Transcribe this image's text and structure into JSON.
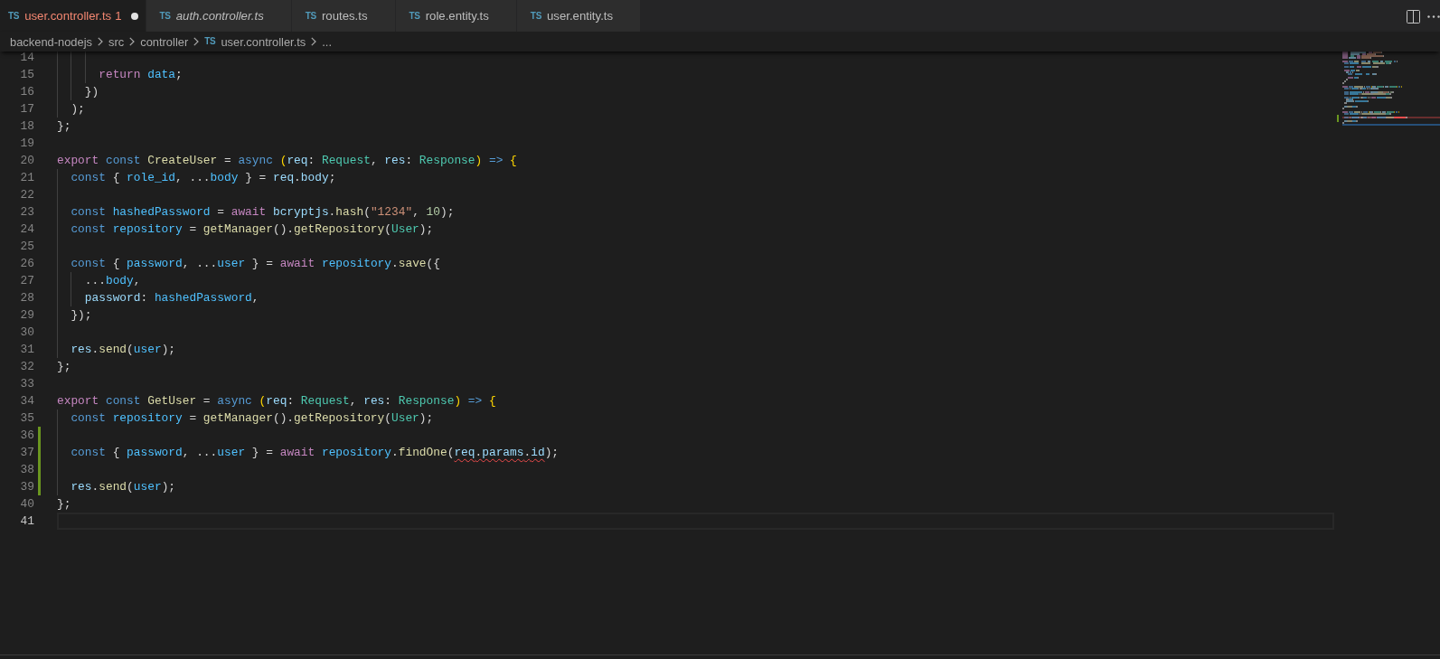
{
  "tabs": [
    {
      "icon": "TS",
      "label": "user.controller.ts",
      "problems": "1",
      "selected": true,
      "preview": false,
      "error": true,
      "dirty": true
    },
    {
      "icon": "TS",
      "label": "auth.controller.ts",
      "selected": false,
      "preview": true,
      "error": false,
      "dirty": false
    },
    {
      "icon": "TS",
      "label": "routes.ts",
      "selected": false,
      "preview": false,
      "error": false,
      "dirty": false
    },
    {
      "icon": "TS",
      "label": "role.entity.ts",
      "selected": false,
      "preview": false,
      "error": false,
      "dirty": false
    },
    {
      "icon": "TS",
      "label": "user.entity.ts",
      "selected": false,
      "preview": false,
      "error": false,
      "dirty": false
    }
  ],
  "breadcrumbs": [
    {
      "kind": "folder",
      "text": "backend-nodejs"
    },
    {
      "kind": "folder",
      "text": "src"
    },
    {
      "kind": "folder",
      "text": "controller"
    },
    {
      "kind": "file",
      "icon": "TS",
      "text": "user.controller.ts"
    },
    {
      "kind": "symbol",
      "text": "..."
    }
  ],
  "editor": {
    "lines": [
      {
        "kind": "block",
        "children": [
          {
            "kind": "block",
            "children": [
              {
                "kind": "block",
                "children": [
                  {
                    "kind": "line",
                    "number": "14",
                    "added": false,
                    "active": false
                  },
                  {
                    "kind": "line",
                    "number": "15",
                    "added": false,
                    "active": false,
                    "tokens": [
                      {
                        "kind": "keyword",
                        "text": "return "
                      },
                      {
                        "kind": "constant",
                        "text": "data"
                      },
                      {
                        "kind": "punct",
                        "text": ";"
                      }
                    ]
                  }
                ]
              },
              {
                "kind": "line",
                "number": "16",
                "added": false,
                "active": false,
                "tokens": [
                  {
                    "kind": "punct",
                    "text": "})"
                  }
                ]
              }
            ]
          },
          {
            "kind": "line",
            "number": "17",
            "added": false,
            "active": false,
            "tokens": [
              {
                "kind": "punct",
                "text": ");"
              }
            ]
          }
        ]
      },
      {
        "kind": "line",
        "number": "18",
        "added": false,
        "active": false,
        "tokens": [
          {
            "kind": "punct",
            "text": "};"
          }
        ]
      },
      {
        "kind": "line",
        "number": "19",
        "added": false,
        "active": false
      },
      {
        "kind": "line",
        "number": "20",
        "added": false,
        "active": false,
        "tokens": [
          {
            "kind": "keyword",
            "text": "export "
          },
          {
            "kind": "storage",
            "text": "const "
          },
          {
            "kind": "function",
            "text": "CreateUser"
          },
          {
            "kind": "punct",
            "text": " = "
          },
          {
            "kind": "storage",
            "text": "async "
          },
          {
            "kind": "bracket",
            "text": "("
          },
          {
            "kind": "variable",
            "text": "req"
          },
          {
            "kind": "punct",
            "text": ": "
          },
          {
            "kind": "type",
            "text": "Request"
          },
          {
            "kind": "punct",
            "text": ", "
          },
          {
            "kind": "variable",
            "text": "res"
          },
          {
            "kind": "punct",
            "text": ": "
          },
          {
            "kind": "type",
            "text": "Response"
          },
          {
            "kind": "bracket",
            "text": ")"
          },
          {
            "kind": "storage",
            "text": " => "
          },
          {
            "kind": "bracket",
            "text": "{"
          }
        ]
      },
      {
        "kind": "block",
        "children": [
          {
            "kind": "line",
            "number": "21",
            "added": false,
            "active": false,
            "tokens": [
              {
                "kind": "storage",
                "text": "const "
              },
              {
                "kind": "punct",
                "text": "{ "
              },
              {
                "kind": "constant",
                "text": "role_id"
              },
              {
                "kind": "punct",
                "text": ", ..."
              },
              {
                "kind": "constant",
                "text": "body"
              },
              {
                "kind": "punct",
                "text": " } = "
              },
              {
                "kind": "variable",
                "text": "req"
              },
              {
                "kind": "punct",
                "text": "."
              },
              {
                "kind": "variable",
                "text": "body"
              },
              {
                "kind": "punct",
                "text": ";"
              }
            ]
          },
          {
            "kind": "line",
            "number": "22",
            "added": false,
            "active": false
          },
          {
            "kind": "line",
            "number": "23",
            "added": false,
            "active": false,
            "tokens": [
              {
                "kind": "storage",
                "text": "const "
              },
              {
                "kind": "constant",
                "text": "hashedPassword"
              },
              {
                "kind": "punct",
                "text": " = "
              },
              {
                "kind": "keyword",
                "text": "await "
              },
              {
                "kind": "variable",
                "text": "bcryptjs"
              },
              {
                "kind": "punct",
                "text": "."
              },
              {
                "kind": "function",
                "text": "hash"
              },
              {
                "kind": "punct",
                "text": "("
              },
              {
                "kind": "string",
                "text": "\"1234\""
              },
              {
                "kind": "punct",
                "text": ", "
              },
              {
                "kind": "number",
                "text": "10"
              },
              {
                "kind": "punct",
                "text": ");"
              }
            ]
          },
          {
            "kind": "line",
            "number": "24",
            "added": false,
            "active": false,
            "tokens": [
              {
                "kind": "storage",
                "text": "const "
              },
              {
                "kind": "constant",
                "text": "repository"
              },
              {
                "kind": "punct",
                "text": " = "
              },
              {
                "kind": "function",
                "text": "getManager"
              },
              {
                "kind": "punct",
                "text": "()."
              },
              {
                "kind": "function",
                "text": "getRepository"
              },
              {
                "kind": "punct",
                "text": "("
              },
              {
                "kind": "type",
                "text": "User"
              },
              {
                "kind": "punct",
                "text": ");"
              }
            ]
          },
          {
            "kind": "line",
            "number": "25",
            "added": false,
            "active": false
          },
          {
            "kind": "line",
            "number": "26",
            "added": false,
            "active": false,
            "tokens": [
              {
                "kind": "storage",
                "text": "const "
              },
              {
                "kind": "punct",
                "text": "{ "
              },
              {
                "kind": "constant",
                "text": "password"
              },
              {
                "kind": "punct",
                "text": ", ..."
              },
              {
                "kind": "constant",
                "text": "user"
              },
              {
                "kind": "punct",
                "text": " } = "
              },
              {
                "kind": "keyword",
                "text": "await "
              },
              {
                "kind": "constant",
                "text": "repository"
              },
              {
                "kind": "punct",
                "text": "."
              },
              {
                "kind": "function",
                "text": "save"
              },
              {
                "kind": "punct",
                "text": "({"
              }
            ]
          },
          {
            "kind": "block",
            "children": [
              {
                "kind": "line",
                "number": "27",
                "added": false,
                "active": false,
                "tokens": [
                  {
                    "kind": "punct",
                    "text": "..."
                  },
                  {
                    "kind": "constant",
                    "text": "body"
                  },
                  {
                    "kind": "punct",
                    "text": ","
                  }
                ]
              },
              {
                "kind": "line",
                "number": "28",
                "added": false,
                "active": false,
                "tokens": [
                  {
                    "kind": "variable",
                    "text": "password"
                  },
                  {
                    "kind": "punct",
                    "text": ": "
                  },
                  {
                    "kind": "constant",
                    "text": "hashedPassword"
                  },
                  {
                    "kind": "punct",
                    "text": ","
                  }
                ]
              }
            ]
          },
          {
            "kind": "line",
            "number": "29",
            "added": false,
            "active": false,
            "tokens": [
              {
                "kind": "punct",
                "text": "});"
              }
            ]
          },
          {
            "kind": "line",
            "number": "30",
            "added": false,
            "active": false
          },
          {
            "kind": "line",
            "number": "31",
            "added": false,
            "active": false,
            "tokens": [
              {
                "kind": "variable",
                "text": "res"
              },
              {
                "kind": "punct",
                "text": "."
              },
              {
                "kind": "function",
                "text": "send"
              },
              {
                "kind": "punct",
                "text": "("
              },
              {
                "kind": "constant",
                "text": "user"
              },
              {
                "kind": "punct",
                "text": ");"
              }
            ]
          }
        ]
      },
      {
        "kind": "line",
        "number": "32",
        "added": false,
        "active": false,
        "tokens": [
          {
            "kind": "punct",
            "text": "};"
          }
        ]
      },
      {
        "kind": "line",
        "number": "33",
        "added": false,
        "active": false
      },
      {
        "kind": "line",
        "number": "34",
        "added": false,
        "active": false,
        "tokens": [
          {
            "kind": "keyword",
            "text": "export "
          },
          {
            "kind": "storage",
            "text": "const "
          },
          {
            "kind": "function",
            "text": "GetUser"
          },
          {
            "kind": "punct",
            "text": " = "
          },
          {
            "kind": "storage",
            "text": "async "
          },
          {
            "kind": "bracket",
            "text": "("
          },
          {
            "kind": "variable",
            "text": "req"
          },
          {
            "kind": "punct",
            "text": ": "
          },
          {
            "kind": "type",
            "text": "Request"
          },
          {
            "kind": "punct",
            "text": ", "
          },
          {
            "kind": "variable",
            "text": "res"
          },
          {
            "kind": "punct",
            "text": ": "
          },
          {
            "kind": "type",
            "text": "Response"
          },
          {
            "kind": "bracket",
            "text": ")"
          },
          {
            "kind": "storage",
            "text": " => "
          },
          {
            "kind": "bracket",
            "text": "{"
          }
        ]
      },
      {
        "kind": "block",
        "children": [
          {
            "kind": "line",
            "number": "35",
            "added": false,
            "active": false,
            "tokens": [
              {
                "kind": "storage",
                "text": "const "
              },
              {
                "kind": "constant",
                "text": "repository"
              },
              {
                "kind": "punct",
                "text": " = "
              },
              {
                "kind": "function",
                "text": "getManager"
              },
              {
                "kind": "punct",
                "text": "()."
              },
              {
                "kind": "function",
                "text": "getRepository"
              },
              {
                "kind": "punct",
                "text": "("
              },
              {
                "kind": "type",
                "text": "User"
              },
              {
                "kind": "punct",
                "text": ");"
              }
            ]
          },
          {
            "kind": "line",
            "number": "36",
            "added": true,
            "active": false
          },
          {
            "kind": "line",
            "number": "37",
            "added": true,
            "active": false,
            "tokens": [
              {
                "kind": "storage",
                "text": "const "
              },
              {
                "kind": "punct",
                "text": "{ "
              },
              {
                "kind": "constant",
                "text": "password"
              },
              {
                "kind": "punct",
                "text": ", ..."
              },
              {
                "kind": "constant",
                "text": "user"
              },
              {
                "kind": "punct",
                "text": " } = "
              },
              {
                "kind": "keyword",
                "text": "await "
              },
              {
                "kind": "constant",
                "text": "repository"
              },
              {
                "kind": "punct",
                "text": "."
              },
              {
                "kind": "function",
                "text": "findOne"
              },
              {
                "kind": "punct",
                "text": "("
              },
              {
                "kind": "error",
                "children": [
                  {
                    "kind": "variable",
                    "text": "req"
                  },
                  {
                    "kind": "punct",
                    "text": "."
                  },
                  {
                    "kind": "variable",
                    "text": "params"
                  },
                  {
                    "kind": "punct",
                    "text": "."
                  },
                  {
                    "kind": "variable",
                    "text": "id"
                  }
                ]
              },
              {
                "kind": "punct",
                "text": ");"
              }
            ]
          },
          {
            "kind": "line",
            "number": "38",
            "added": true,
            "active": false
          },
          {
            "kind": "line",
            "number": "39",
            "added": true,
            "active": false,
            "tokens": [
              {
                "kind": "variable",
                "text": "res"
              },
              {
                "kind": "punct",
                "text": "."
              },
              {
                "kind": "function",
                "text": "send"
              },
              {
                "kind": "punct",
                "text": "("
              },
              {
                "kind": "constant",
                "text": "user"
              },
              {
                "kind": "punct",
                "text": ");"
              }
            ]
          }
        ]
      },
      {
        "kind": "line",
        "number": "40",
        "added": false,
        "active": false,
        "tokens": [
          {
            "kind": "punct",
            "text": "};"
          }
        ]
      },
      {
        "kind": "line",
        "number": "41",
        "added": false,
        "active": true
      }
    ]
  }
}
